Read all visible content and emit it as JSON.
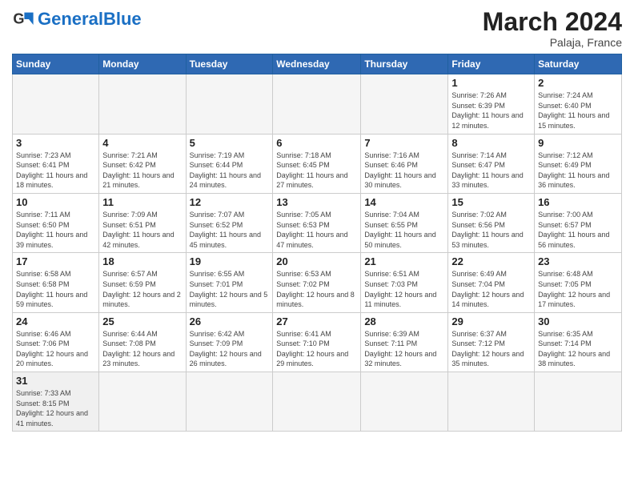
{
  "header": {
    "logo_general": "General",
    "logo_blue": "Blue",
    "month_title": "March 2024",
    "subtitle": "Palaja, France"
  },
  "weekdays": [
    "Sunday",
    "Monday",
    "Tuesday",
    "Wednesday",
    "Thursday",
    "Friday",
    "Saturday"
  ],
  "weeks": [
    [
      {
        "day": "",
        "info": ""
      },
      {
        "day": "",
        "info": ""
      },
      {
        "day": "",
        "info": ""
      },
      {
        "day": "",
        "info": ""
      },
      {
        "day": "",
        "info": ""
      },
      {
        "day": "1",
        "info": "Sunrise: 7:26 AM\nSunset: 6:39 PM\nDaylight: 11 hours and 12 minutes."
      },
      {
        "day": "2",
        "info": "Sunrise: 7:24 AM\nSunset: 6:40 PM\nDaylight: 11 hours and 15 minutes."
      }
    ],
    [
      {
        "day": "3",
        "info": "Sunrise: 7:23 AM\nSunset: 6:41 PM\nDaylight: 11 hours and 18 minutes."
      },
      {
        "day": "4",
        "info": "Sunrise: 7:21 AM\nSunset: 6:42 PM\nDaylight: 11 hours and 21 minutes."
      },
      {
        "day": "5",
        "info": "Sunrise: 7:19 AM\nSunset: 6:44 PM\nDaylight: 11 hours and 24 minutes."
      },
      {
        "day": "6",
        "info": "Sunrise: 7:18 AM\nSunset: 6:45 PM\nDaylight: 11 hours and 27 minutes."
      },
      {
        "day": "7",
        "info": "Sunrise: 7:16 AM\nSunset: 6:46 PM\nDaylight: 11 hours and 30 minutes."
      },
      {
        "day": "8",
        "info": "Sunrise: 7:14 AM\nSunset: 6:47 PM\nDaylight: 11 hours and 33 minutes."
      },
      {
        "day": "9",
        "info": "Sunrise: 7:12 AM\nSunset: 6:49 PM\nDaylight: 11 hours and 36 minutes."
      }
    ],
    [
      {
        "day": "10",
        "info": "Sunrise: 7:11 AM\nSunset: 6:50 PM\nDaylight: 11 hours and 39 minutes."
      },
      {
        "day": "11",
        "info": "Sunrise: 7:09 AM\nSunset: 6:51 PM\nDaylight: 11 hours and 42 minutes."
      },
      {
        "day": "12",
        "info": "Sunrise: 7:07 AM\nSunset: 6:52 PM\nDaylight: 11 hours and 45 minutes."
      },
      {
        "day": "13",
        "info": "Sunrise: 7:05 AM\nSunset: 6:53 PM\nDaylight: 11 hours and 47 minutes."
      },
      {
        "day": "14",
        "info": "Sunrise: 7:04 AM\nSunset: 6:55 PM\nDaylight: 11 hours and 50 minutes."
      },
      {
        "day": "15",
        "info": "Sunrise: 7:02 AM\nSunset: 6:56 PM\nDaylight: 11 hours and 53 minutes."
      },
      {
        "day": "16",
        "info": "Sunrise: 7:00 AM\nSunset: 6:57 PM\nDaylight: 11 hours and 56 minutes."
      }
    ],
    [
      {
        "day": "17",
        "info": "Sunrise: 6:58 AM\nSunset: 6:58 PM\nDaylight: 11 hours and 59 minutes."
      },
      {
        "day": "18",
        "info": "Sunrise: 6:57 AM\nSunset: 6:59 PM\nDaylight: 12 hours and 2 minutes."
      },
      {
        "day": "19",
        "info": "Sunrise: 6:55 AM\nSunset: 7:01 PM\nDaylight: 12 hours and 5 minutes."
      },
      {
        "day": "20",
        "info": "Sunrise: 6:53 AM\nSunset: 7:02 PM\nDaylight: 12 hours and 8 minutes."
      },
      {
        "day": "21",
        "info": "Sunrise: 6:51 AM\nSunset: 7:03 PM\nDaylight: 12 hours and 11 minutes."
      },
      {
        "day": "22",
        "info": "Sunrise: 6:49 AM\nSunset: 7:04 PM\nDaylight: 12 hours and 14 minutes."
      },
      {
        "day": "23",
        "info": "Sunrise: 6:48 AM\nSunset: 7:05 PM\nDaylight: 12 hours and 17 minutes."
      }
    ],
    [
      {
        "day": "24",
        "info": "Sunrise: 6:46 AM\nSunset: 7:06 PM\nDaylight: 12 hours and 20 minutes."
      },
      {
        "day": "25",
        "info": "Sunrise: 6:44 AM\nSunset: 7:08 PM\nDaylight: 12 hours and 23 minutes."
      },
      {
        "day": "26",
        "info": "Sunrise: 6:42 AM\nSunset: 7:09 PM\nDaylight: 12 hours and 26 minutes."
      },
      {
        "day": "27",
        "info": "Sunrise: 6:41 AM\nSunset: 7:10 PM\nDaylight: 12 hours and 29 minutes."
      },
      {
        "day": "28",
        "info": "Sunrise: 6:39 AM\nSunset: 7:11 PM\nDaylight: 12 hours and 32 minutes."
      },
      {
        "day": "29",
        "info": "Sunrise: 6:37 AM\nSunset: 7:12 PM\nDaylight: 12 hours and 35 minutes."
      },
      {
        "day": "30",
        "info": "Sunrise: 6:35 AM\nSunset: 7:14 PM\nDaylight: 12 hours and 38 minutes."
      }
    ],
    [
      {
        "day": "31",
        "info": "Sunrise: 7:33 AM\nSunset: 8:15 PM\nDaylight: 12 hours and 41 minutes."
      },
      {
        "day": "",
        "info": ""
      },
      {
        "day": "",
        "info": ""
      },
      {
        "day": "",
        "info": ""
      },
      {
        "day": "",
        "info": ""
      },
      {
        "day": "",
        "info": ""
      },
      {
        "day": "",
        "info": ""
      }
    ]
  ]
}
